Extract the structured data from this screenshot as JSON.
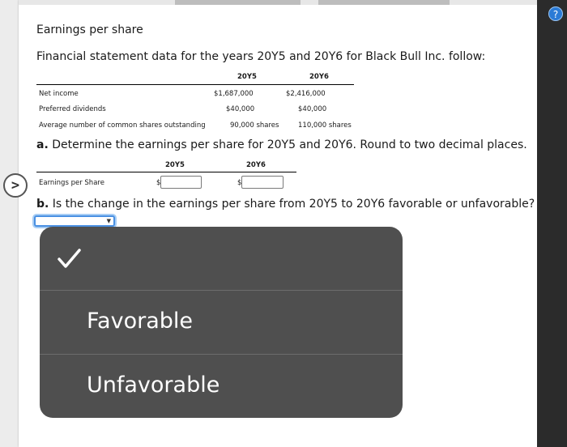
{
  "title": "Earnings per share",
  "intro": "Financial statement data for the years 20Y5 and 20Y6 for Black Bull Inc. follow:",
  "table": {
    "headers": [
      "20Y5",
      "20Y6"
    ],
    "rows": [
      {
        "label": "Net income",
        "y5": "$1,687,000",
        "y6": "$2,416,000"
      },
      {
        "label": "Preferred dividends",
        "y5": "$40,000",
        "y6": "$40,000"
      },
      {
        "label": "Average number of common shares outstanding",
        "y5": "90,000 shares",
        "y6": "110,000 shares"
      }
    ]
  },
  "question_a": {
    "prefix": "a.",
    "text": " Determine the earnings per share for 20Y5 and 20Y6. Round to two decimal places."
  },
  "answer_table": {
    "headers": [
      "20Y5",
      "20Y6"
    ],
    "row_label": "Earnings per Share",
    "currency": "$",
    "y5_value": "",
    "y6_value": ""
  },
  "question_b": {
    "prefix": "b.",
    "text": " Is the change in the earnings per share from 20Y5 to 20Y6 favorable or unfavorable?"
  },
  "dropdown": {
    "selected": "",
    "options": [
      "",
      "Favorable",
      "Unfavorable"
    ]
  },
  "icons": {
    "help": "help-circle-icon",
    "expand": "chevron-right-circle-icon",
    "check": "checkmark-icon"
  },
  "colors": {
    "menu_bg": "#4f4f4f",
    "focus": "#4a90e2",
    "help": "#2b7bd6"
  }
}
